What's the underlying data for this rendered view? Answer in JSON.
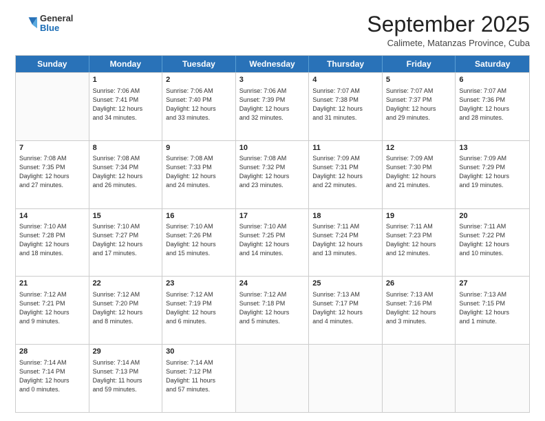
{
  "logo": {
    "general": "General",
    "blue": "Blue"
  },
  "header": {
    "month": "September 2025",
    "location": "Calimete, Matanzas Province, Cuba"
  },
  "days": [
    "Sunday",
    "Monday",
    "Tuesday",
    "Wednesday",
    "Thursday",
    "Friday",
    "Saturday"
  ],
  "weeks": [
    [
      {
        "day": "",
        "info": ""
      },
      {
        "day": "1",
        "info": "Sunrise: 7:06 AM\nSunset: 7:41 PM\nDaylight: 12 hours\nand 34 minutes."
      },
      {
        "day": "2",
        "info": "Sunrise: 7:06 AM\nSunset: 7:40 PM\nDaylight: 12 hours\nand 33 minutes."
      },
      {
        "day": "3",
        "info": "Sunrise: 7:06 AM\nSunset: 7:39 PM\nDaylight: 12 hours\nand 32 minutes."
      },
      {
        "day": "4",
        "info": "Sunrise: 7:07 AM\nSunset: 7:38 PM\nDaylight: 12 hours\nand 31 minutes."
      },
      {
        "day": "5",
        "info": "Sunrise: 7:07 AM\nSunset: 7:37 PM\nDaylight: 12 hours\nand 29 minutes."
      },
      {
        "day": "6",
        "info": "Sunrise: 7:07 AM\nSunset: 7:36 PM\nDaylight: 12 hours\nand 28 minutes."
      }
    ],
    [
      {
        "day": "7",
        "info": "Sunrise: 7:08 AM\nSunset: 7:35 PM\nDaylight: 12 hours\nand 27 minutes."
      },
      {
        "day": "8",
        "info": "Sunrise: 7:08 AM\nSunset: 7:34 PM\nDaylight: 12 hours\nand 26 minutes."
      },
      {
        "day": "9",
        "info": "Sunrise: 7:08 AM\nSunset: 7:33 PM\nDaylight: 12 hours\nand 24 minutes."
      },
      {
        "day": "10",
        "info": "Sunrise: 7:08 AM\nSunset: 7:32 PM\nDaylight: 12 hours\nand 23 minutes."
      },
      {
        "day": "11",
        "info": "Sunrise: 7:09 AM\nSunset: 7:31 PM\nDaylight: 12 hours\nand 22 minutes."
      },
      {
        "day": "12",
        "info": "Sunrise: 7:09 AM\nSunset: 7:30 PM\nDaylight: 12 hours\nand 21 minutes."
      },
      {
        "day": "13",
        "info": "Sunrise: 7:09 AM\nSunset: 7:29 PM\nDaylight: 12 hours\nand 19 minutes."
      }
    ],
    [
      {
        "day": "14",
        "info": "Sunrise: 7:10 AM\nSunset: 7:28 PM\nDaylight: 12 hours\nand 18 minutes."
      },
      {
        "day": "15",
        "info": "Sunrise: 7:10 AM\nSunset: 7:27 PM\nDaylight: 12 hours\nand 17 minutes."
      },
      {
        "day": "16",
        "info": "Sunrise: 7:10 AM\nSunset: 7:26 PM\nDaylight: 12 hours\nand 15 minutes."
      },
      {
        "day": "17",
        "info": "Sunrise: 7:10 AM\nSunset: 7:25 PM\nDaylight: 12 hours\nand 14 minutes."
      },
      {
        "day": "18",
        "info": "Sunrise: 7:11 AM\nSunset: 7:24 PM\nDaylight: 12 hours\nand 13 minutes."
      },
      {
        "day": "19",
        "info": "Sunrise: 7:11 AM\nSunset: 7:23 PM\nDaylight: 12 hours\nand 12 minutes."
      },
      {
        "day": "20",
        "info": "Sunrise: 7:11 AM\nSunset: 7:22 PM\nDaylight: 12 hours\nand 10 minutes."
      }
    ],
    [
      {
        "day": "21",
        "info": "Sunrise: 7:12 AM\nSunset: 7:21 PM\nDaylight: 12 hours\nand 9 minutes."
      },
      {
        "day": "22",
        "info": "Sunrise: 7:12 AM\nSunset: 7:20 PM\nDaylight: 12 hours\nand 8 minutes."
      },
      {
        "day": "23",
        "info": "Sunrise: 7:12 AM\nSunset: 7:19 PM\nDaylight: 12 hours\nand 6 minutes."
      },
      {
        "day": "24",
        "info": "Sunrise: 7:12 AM\nSunset: 7:18 PM\nDaylight: 12 hours\nand 5 minutes."
      },
      {
        "day": "25",
        "info": "Sunrise: 7:13 AM\nSunset: 7:17 PM\nDaylight: 12 hours\nand 4 minutes."
      },
      {
        "day": "26",
        "info": "Sunrise: 7:13 AM\nSunset: 7:16 PM\nDaylight: 12 hours\nand 3 minutes."
      },
      {
        "day": "27",
        "info": "Sunrise: 7:13 AM\nSunset: 7:15 PM\nDaylight: 12 hours\nand 1 minute."
      }
    ],
    [
      {
        "day": "28",
        "info": "Sunrise: 7:14 AM\nSunset: 7:14 PM\nDaylight: 12 hours\nand 0 minutes."
      },
      {
        "day": "29",
        "info": "Sunrise: 7:14 AM\nSunset: 7:13 PM\nDaylight: 11 hours\nand 59 minutes."
      },
      {
        "day": "30",
        "info": "Sunrise: 7:14 AM\nSunset: 7:12 PM\nDaylight: 11 hours\nand 57 minutes."
      },
      {
        "day": "",
        "info": ""
      },
      {
        "day": "",
        "info": ""
      },
      {
        "day": "",
        "info": ""
      },
      {
        "day": "",
        "info": ""
      }
    ]
  ]
}
